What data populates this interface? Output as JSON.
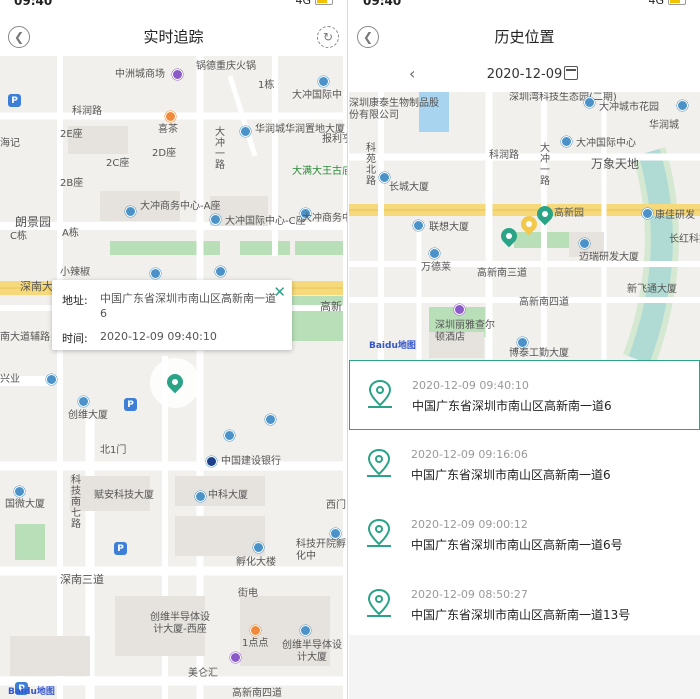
{
  "status": {
    "time": "09:40",
    "network": "4G"
  },
  "left": {
    "title": "实时追踪",
    "popup": {
      "address_label": "地址:",
      "address_value": "中国广东省深圳市南山区高新南一道6",
      "time_label": "时间:",
      "time_value": "2020-12-09 09:40:10"
    },
    "map_labels": [
      "中洲城商场",
      "锅德重庆火锅",
      "1栋",
      "大冲国际中",
      "科润路",
      "喜茶",
      "华润城华润置地大厦",
      "报利亨",
      "海记",
      "2E座",
      "2D座",
      "2C座",
      "2B座",
      "大满大王古庙",
      "朗景园",
      "C栋",
      "A栋",
      "大冲商务中心-A座",
      "大冲国际中心-C座",
      "大冲商务中心",
      "小辣椒",
      "深南大道",
      "高新",
      "南大道辅路",
      "兴业",
      "创维大厦",
      "北1门",
      "中国建设银行",
      "国微大厦",
      "赋安科技大厦",
      "中科大厦",
      "科技南七路",
      "西门",
      "科技开院孵化中",
      "孵化大楼",
      "深南三道",
      "街电",
      "创维半导体设计大厦-西座",
      "1点点",
      "创维半导体设计大厦",
      "美仑汇",
      "高新南四道",
      "大冲一路"
    ],
    "logo_text": "Baidu地图"
  },
  "right": {
    "title": "历史位置",
    "date": "2020-12-09",
    "map_labels": [
      "深圳康泰生物制品股份有限公司",
      "深圳湾科技生态园(二期)",
      "大冲城市花园",
      "华润城",
      "科润路",
      "大冲国际中心",
      "万象天地",
      "大冲一路",
      "长城大厦",
      "科苑北路",
      "高新园",
      "康佳研发",
      "长红科技",
      "联想大厦",
      "万德莱",
      "迈瑞研发大厦",
      "高新南三道",
      "高新南四道",
      "深圳丽雅查尔顿酒店",
      "博泰工勤大厦",
      "新飞通大厦"
    ],
    "logo_text": "Baidu地图",
    "history": [
      {
        "time": "2020-12-09 09:40:10",
        "address": "中国广东省深圳市南山区高新南一道6"
      },
      {
        "time": "2020-12-09 09:16:06",
        "address": "中国广东省深圳市南山区高新南一道6"
      },
      {
        "time": "2020-12-09 09:00:12",
        "address": "中国广东省深圳市南山区高新南一道6号"
      },
      {
        "time": "2020-12-09 08:50:27",
        "address": "中国广东省深圳市南山区高新南一道13号"
      }
    ]
  },
  "colors": {
    "accent": "#2aa387",
    "pin_yellow": "#f2c94c",
    "road": "#ffffff",
    "highway": "#f6d97a",
    "green": "#b8dfb8",
    "water": "#a8d4f0"
  }
}
